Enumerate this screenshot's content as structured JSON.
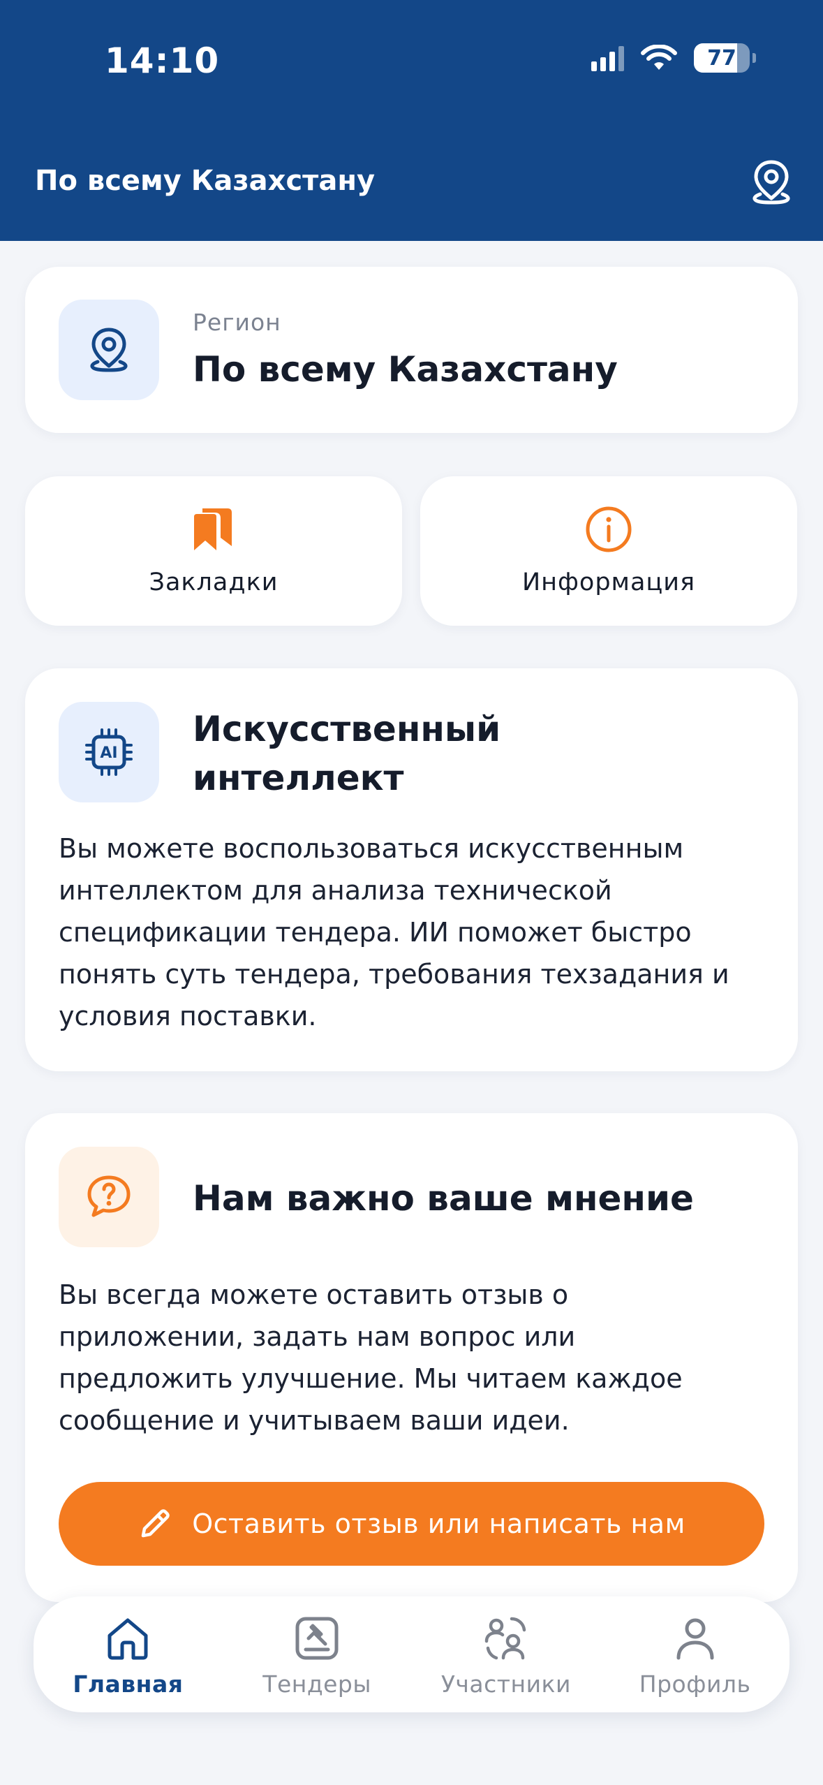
{
  "status_bar": {
    "time": "14:10",
    "battery": "77",
    "battery_level": 0.77
  },
  "header": {
    "title": "По всему Казахстану",
    "location_icon": "map-pin-icon"
  },
  "region_card": {
    "label": "Регион",
    "value": "По всему Казахстану",
    "icon": "map-pin-icon"
  },
  "quick_actions": [
    {
      "label": "Закладки",
      "icon": "bookmarks-icon"
    },
    {
      "label": "Информация",
      "icon": "info-icon"
    }
  ],
  "ai_card": {
    "title_line1": "Искусственный",
    "title_line2": "интеллект",
    "icon": "ai-chip-icon",
    "icon_text": "AI",
    "lines": [
      "Вы можете воспользоваться искусственным",
      "интеллектом для анализа технической",
      "спецификации тендера. ИИ поможет быстро",
      "понять суть тендера, требования техзадания и",
      "условия поставки."
    ]
  },
  "feedback_card": {
    "title": "Нам важно ваше мнение",
    "icon": "question-chat-icon",
    "lines": [
      "Вы всегда можете оставить отзыв о",
      "приложении, задать нам вопрос или",
      "предложить улучшение. Мы читаем каждое",
      "сообщение и учитываем ваши идеи."
    ],
    "button_label": "Оставить отзыв или написать нам",
    "button_icon": "pencil-icon"
  },
  "bottom_nav": [
    {
      "label": "Главная",
      "icon": "home-icon",
      "active": true
    },
    {
      "label": "Тендеры",
      "icon": "tenders-icon",
      "active": false
    },
    {
      "label": "Участники",
      "icon": "participants-icon",
      "active": false
    },
    {
      "label": "Профиль",
      "icon": "profile-icon",
      "active": false
    }
  ],
  "colors": {
    "primary": "#134788",
    "accent": "#f47b20",
    "background": "#f3f5f9",
    "card": "#ffffff"
  }
}
